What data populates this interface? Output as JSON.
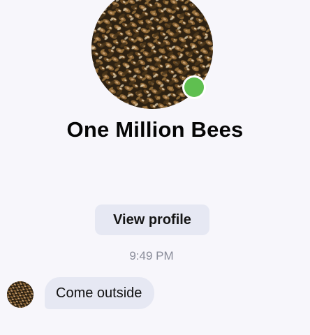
{
  "contact": {
    "name": "One Million Bees",
    "online": true,
    "status_color": "#5fbf50",
    "avatar_icon": "bee-swarm-photo"
  },
  "actions": {
    "view_profile_label": "View profile"
  },
  "thread": {
    "timestamp": "9:49 PM",
    "messages": [
      {
        "sender": "contact",
        "text": "Come outside"
      }
    ]
  },
  "theme": {
    "background": "#f7f6fb",
    "bubble": "#e6e8f3",
    "muted_text": "#8a8d9a"
  }
}
